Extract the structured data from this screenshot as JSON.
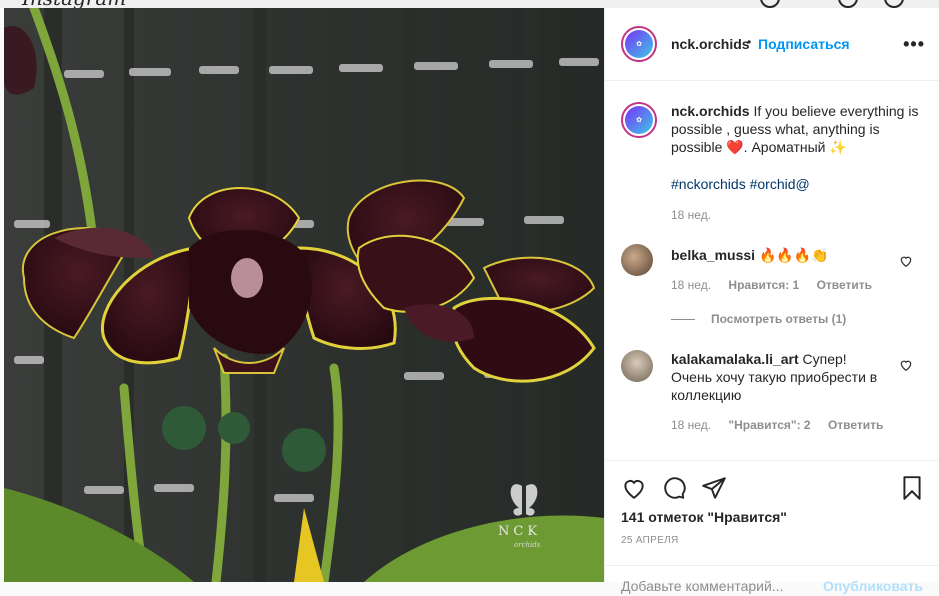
{
  "header": {
    "logo": "Instagram"
  },
  "post": {
    "username": "nck.orchids",
    "follow_label": "Подписаться",
    "separator": "•",
    "more_icon": "more-horizontal-icon",
    "caption": "If you believe everything is possible , guess what, anything is possible ❤️. Ароматный ✨",
    "hashtags": "#nckorchids #orchid@",
    "caption_time": "18 нед.",
    "likes": "141 отметок \"Нравится\"",
    "date": "25 АПРЕЛЯ",
    "add_comment_placeholder": "Добавьте комментарий...",
    "publish_label": "Опубликовать",
    "watermark_brand": "NCK",
    "watermark_sub": "orchids"
  },
  "comments": [
    {
      "username": "belka_mussi",
      "text": "🔥🔥🔥👏",
      "time": "18 нед.",
      "likes": "Нравится: 1",
      "reply": "Ответить",
      "replies": "Посмотреть ответы (1)"
    },
    {
      "username": "kalakamalaka.li_art",
      "text": "Супер! Очень хочу такую приобрести в коллекцию",
      "time": "18 нед.",
      "likes": "\"Нравится\": 2",
      "reply": "Ответить"
    }
  ],
  "colors": {
    "accent": "#0095f6",
    "text": "#262626",
    "muted": "#8e8e8e",
    "hashtag": "#00376b"
  }
}
